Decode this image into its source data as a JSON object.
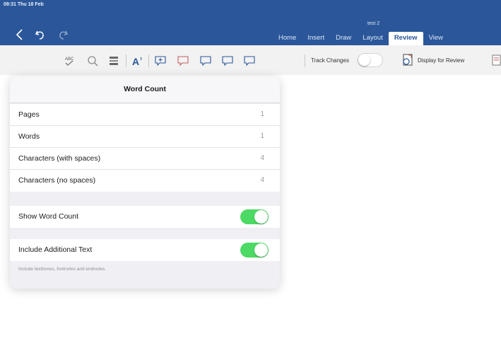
{
  "status_bar": {
    "time": "09:31  Thu 18 Feb"
  },
  "document": {
    "title": "test 2"
  },
  "nav": {
    "back_icon": "chevron-left-icon",
    "undo_icon": "undo-icon",
    "redo_icon": "redo-icon"
  },
  "tabs": [
    {
      "label": "Home",
      "active": false
    },
    {
      "label": "Insert",
      "active": false
    },
    {
      "label": "Draw",
      "active": false
    },
    {
      "label": "Layout",
      "active": false
    },
    {
      "label": "Review",
      "active": true
    },
    {
      "label": "View",
      "active": false
    }
  ],
  "ribbon": {
    "icons": [
      "spelling-icon",
      "smart-lookup-icon",
      "word-count-icon",
      "read-aloud-icon",
      "new-comment-icon",
      "delete-comment-icon",
      "previous-comment-icon",
      "next-comment-icon",
      "show-comments-icon"
    ],
    "track_changes_label": "Track Changes",
    "track_changes_on": false,
    "display_for_review_label": "Display for Review"
  },
  "word_count": {
    "title": "Word Count",
    "stats": [
      {
        "label": "Pages",
        "value": "1"
      },
      {
        "label": "Words",
        "value": "1"
      },
      {
        "label": "Characters (with spaces)",
        "value": "4"
      },
      {
        "label": "Characters (no spaces)",
        "value": "4"
      }
    ],
    "show_word_count_label": "Show Word Count",
    "show_word_count_on": true,
    "include_additional_label": "Include Additional Text",
    "include_additional_on": true,
    "footnote": "Include textboxes, footnotes and endnotes."
  },
  "colors": {
    "accent": "#2b579a",
    "switch_on": "#4cd964",
    "ribbon_bg": "#f2f2f2",
    "popover_bg": "#efeff4"
  }
}
